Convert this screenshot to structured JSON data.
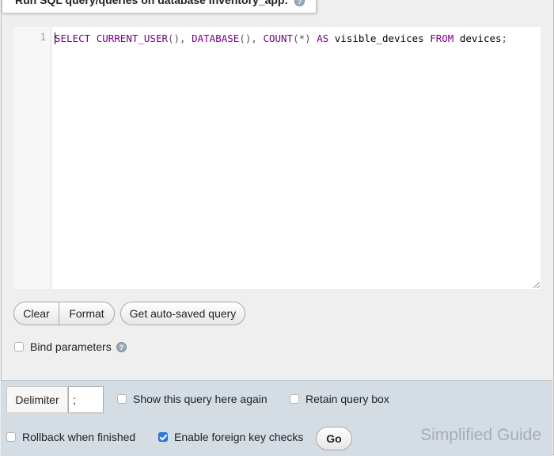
{
  "fieldset": {
    "legend": "Run SQL query/queries on database inventory_app:",
    "help_icon": "help-icon"
  },
  "editor": {
    "line_number": "1",
    "query_text": "SELECT CURRENT_USER(), DATABASE(), COUNT(*) AS visible_devices FROM devices;"
  },
  "buttons": {
    "clear": "Clear",
    "format": "Format",
    "get_autosaved": "Get auto-saved query",
    "go": "Go"
  },
  "options": {
    "bind_parameters": {
      "label": "Bind parameters",
      "checked": false
    }
  },
  "footer": {
    "delimiter_label": "Delimiter",
    "delimiter_value": ";",
    "show_query_again": {
      "label": "Show this query here again",
      "checked": false
    },
    "retain_query_box": {
      "label": "Retain query box",
      "checked": false
    },
    "rollback_when_finished": {
      "label": "Rollback when finished",
      "checked": false
    },
    "enable_foreign_key_checks": {
      "label": "Enable foreign key checks",
      "checked": true
    }
  },
  "watermark": "Simplified Guide",
  "colors": {
    "keyword": "#770088",
    "checkbox_checked": "#2f7ae5",
    "footer_bg": "#d4dce4"
  }
}
